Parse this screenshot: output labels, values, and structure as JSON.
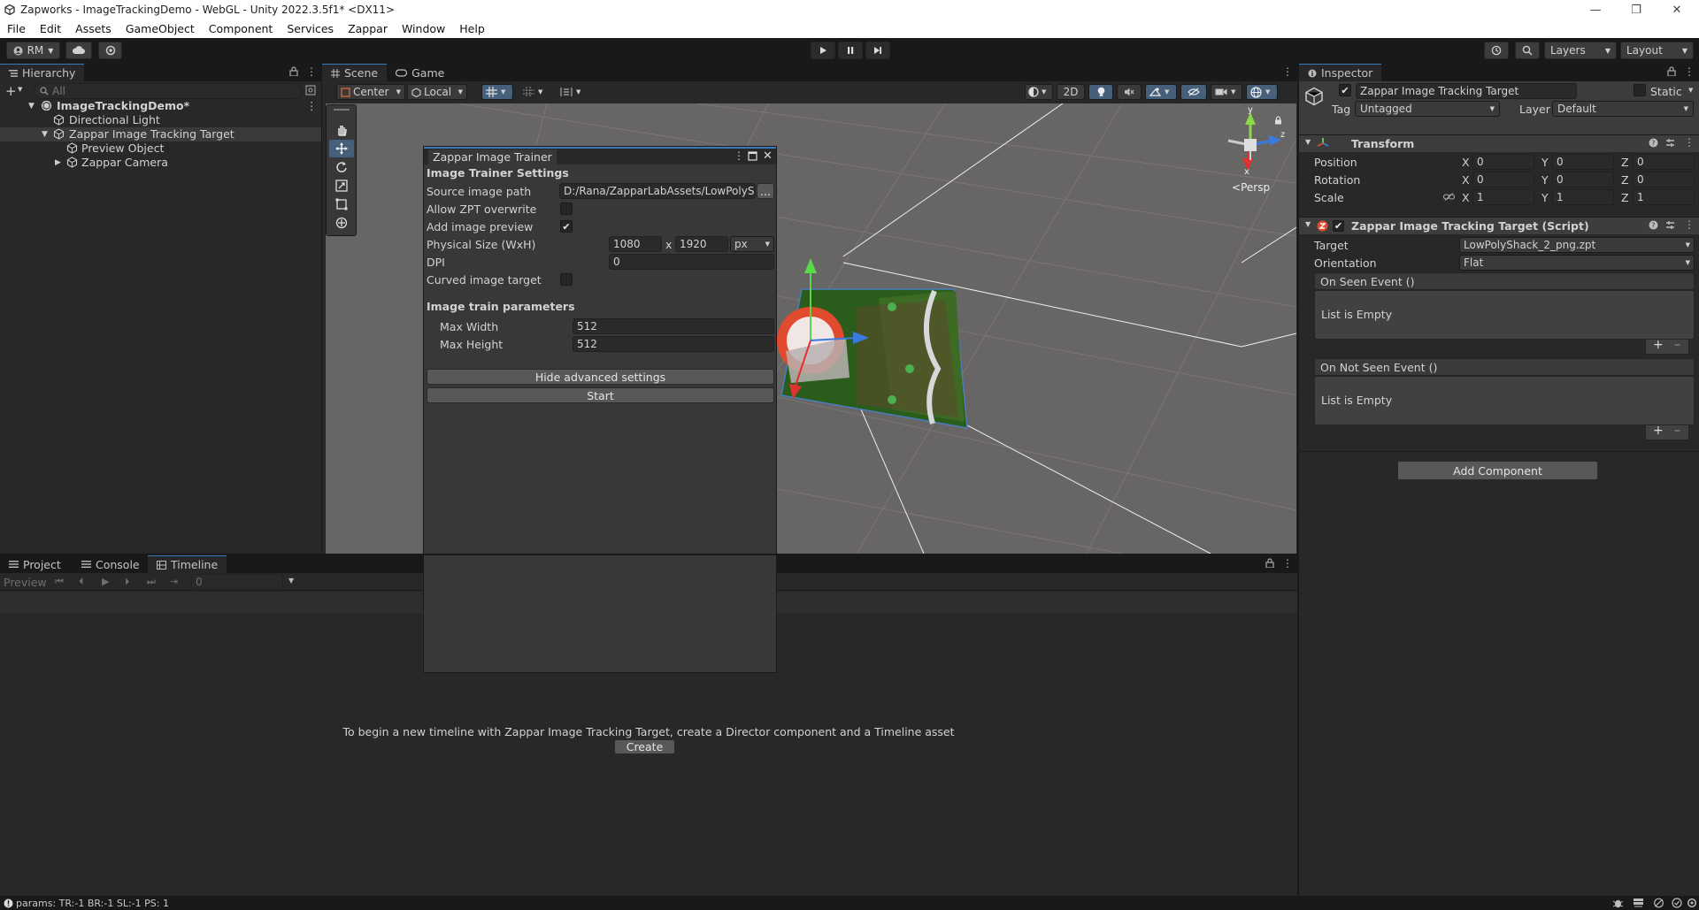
{
  "window": {
    "title": "Zapworks - ImageTrackingDemo - WebGL - Unity 2022.3.5f1* <DX11>",
    "controls": {
      "minimize": "—",
      "maximize": "❐",
      "close": "✕"
    }
  },
  "menu": {
    "items": [
      "File",
      "Edit",
      "Assets",
      "GameObject",
      "Component",
      "Services",
      "Zappar",
      "Window",
      "Help"
    ]
  },
  "toolbar": {
    "account": "RM",
    "layers": "Layers",
    "layout": "Layout"
  },
  "hierarchy": {
    "tab": "Hierarchy",
    "search_placeholder": "All",
    "scene": "ImageTrackingDemo*",
    "items": [
      "Directional Light",
      "Zappar Image Tracking Target",
      "Preview Object",
      "Zappar Camera"
    ]
  },
  "scene_tabs": {
    "scene": "Scene",
    "game": "Game"
  },
  "scene_toolbar": {
    "pivot": "Center",
    "space": "Local",
    "mode_2d": "2D",
    "persp": "Persp",
    "gizmo_y": "y",
    "gizmo_z": "z",
    "gizmo_x": "x"
  },
  "trainer": {
    "title": "Zappar Image Trainer",
    "section": "Image Trainer Settings",
    "source_label": "Source image path",
    "source_value": "D:/Rana/ZapparLabAssets/LowPolySh",
    "browse": "...",
    "allow_zpt_label": "Allow ZPT overwrite",
    "add_preview_label": "Add image preview",
    "size_label": "Physical Size (WxH)",
    "width": "1080",
    "x": "x",
    "height": "1920",
    "unit": "px",
    "dpi_label": "DPI",
    "dpi": "0",
    "curved_label": "Curved image target",
    "params_section": "Image train parameters",
    "max_width_label": "Max Width",
    "max_width": "512",
    "max_height_label": "Max Height",
    "max_height": "512",
    "hide_advanced": "Hide advanced settings",
    "start": "Start",
    "allow_zpt_checked": false,
    "add_preview_checked": true,
    "curved_checked": false
  },
  "bottom": {
    "tabs": [
      "Project",
      "Console",
      "Timeline"
    ],
    "preview": "Preview",
    "frame": "0",
    "message": "To begin a new timeline with Zappar Image Tracking Target, create a Director component and a Timeline asset",
    "create": "Create"
  },
  "inspector": {
    "tab": "Inspector",
    "object_name": "Zappar Image Tracking Target",
    "static": "Static",
    "tag_label": "Tag",
    "tag": "Untagged",
    "layer_label": "Layer",
    "layer": "Default",
    "transform": {
      "title": "Transform",
      "position": "Position",
      "rotation": "Rotation",
      "scale": "Scale",
      "axes": [
        "X",
        "Y",
        "Z"
      ],
      "pos": [
        "0",
        "0",
        "0"
      ],
      "rot": [
        "0",
        "0",
        "0"
      ],
      "scl": [
        "1",
        "1",
        "1"
      ]
    },
    "script": {
      "title": "Zappar Image Tracking Target (Script)",
      "target_label": "Target",
      "target": "LowPolyShack_2_png.zpt",
      "orientation_label": "Orientation",
      "orientation": "Flat",
      "on_seen": "On Seen Event ()",
      "on_not_seen": "On Not Seen Event ()",
      "empty": "List is Empty",
      "plus": "+",
      "minus": "–"
    },
    "add_component": "Add Component"
  },
  "status": {
    "text": "params: TR:-1 BR:-1 SL:-1 PS: 1"
  },
  "colors": {
    "accent": "#3a79bb",
    "selection": "#46607c",
    "panel": "#282828",
    "scene_bg": "#686565"
  }
}
